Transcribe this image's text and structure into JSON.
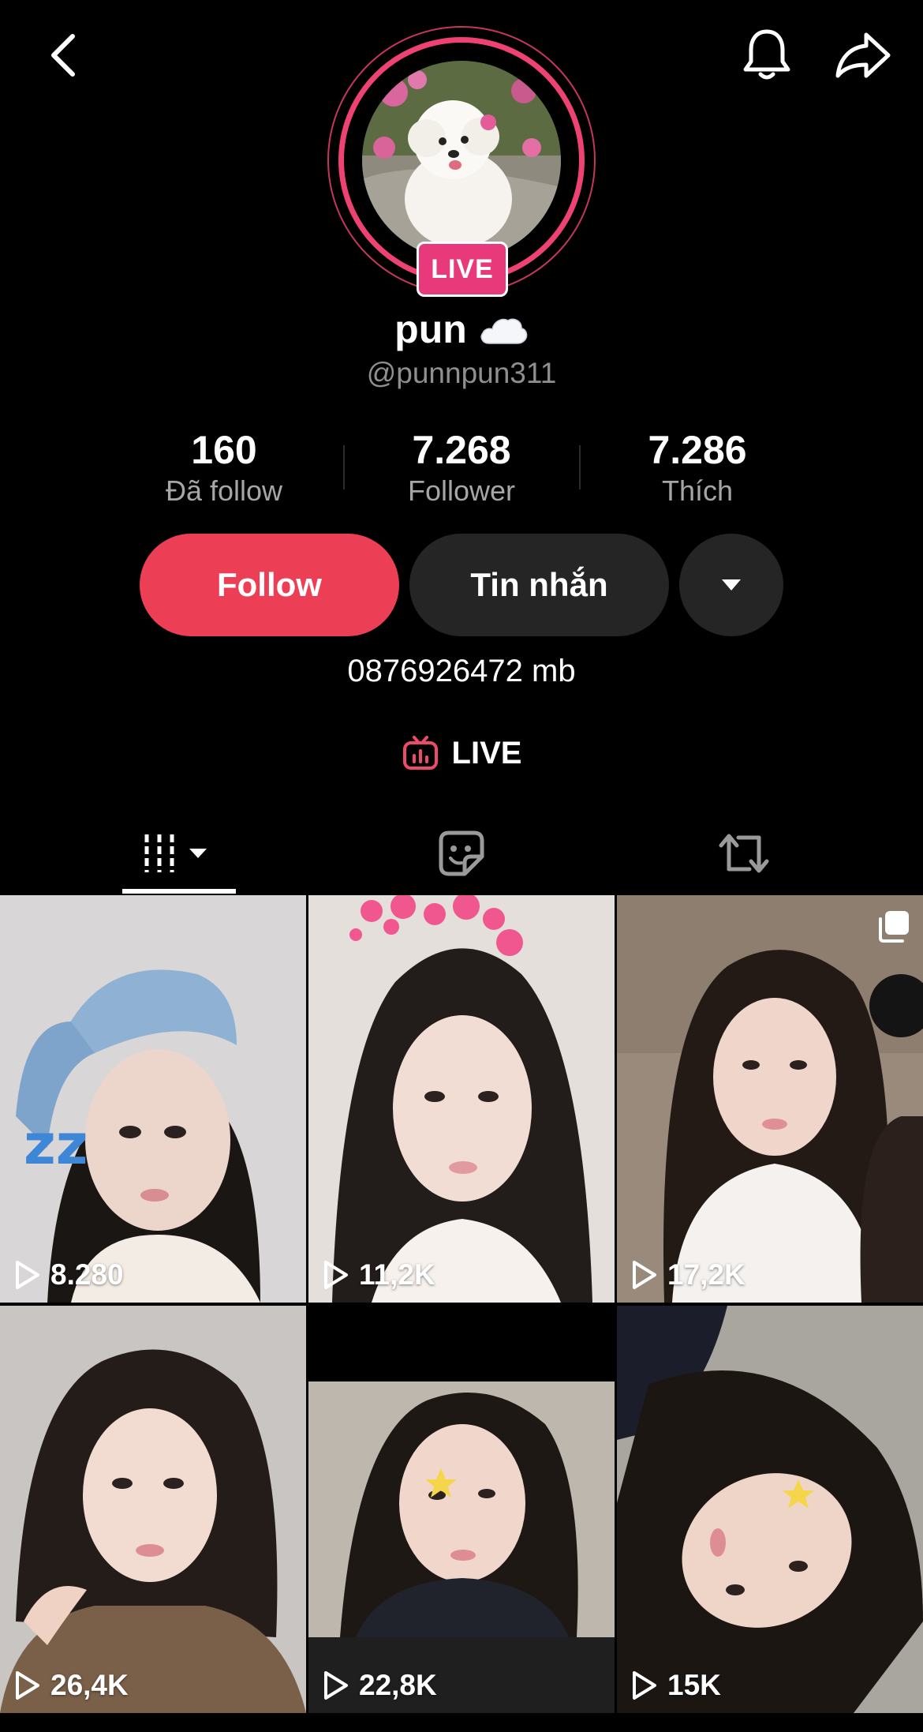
{
  "profile": {
    "name": "pun",
    "name_emoji": "☁️",
    "handle": "@punnpun311",
    "live_badge": "LIVE",
    "bio": "0876926472 mb"
  },
  "stats": [
    {
      "value": "160",
      "label": "Đã follow"
    },
    {
      "value": "7.268",
      "label": "Follower"
    },
    {
      "value": "7.286",
      "label": "Thích"
    }
  ],
  "actions": {
    "follow_label": "Follow",
    "message_label": "Tin nhắn"
  },
  "live_link": {
    "label": "LIVE"
  },
  "tabs": [
    {
      "icon": "videos-grid-icon",
      "active": true
    },
    {
      "icon": "sticker-icon",
      "active": false
    },
    {
      "icon": "repost-icon",
      "active": false
    }
  ],
  "videos": [
    {
      "views": "8.280"
    },
    {
      "views": "11,2K"
    },
    {
      "views": "17,2K",
      "multi": true
    },
    {
      "views": "26,4K"
    },
    {
      "views": "22,8K"
    },
    {
      "views": "15K"
    }
  ],
  "colors": {
    "accent": "#ec3f56",
    "live_pink": "#e8397a",
    "secondary_button": "#252525",
    "muted_text": "#a6a6a6"
  }
}
